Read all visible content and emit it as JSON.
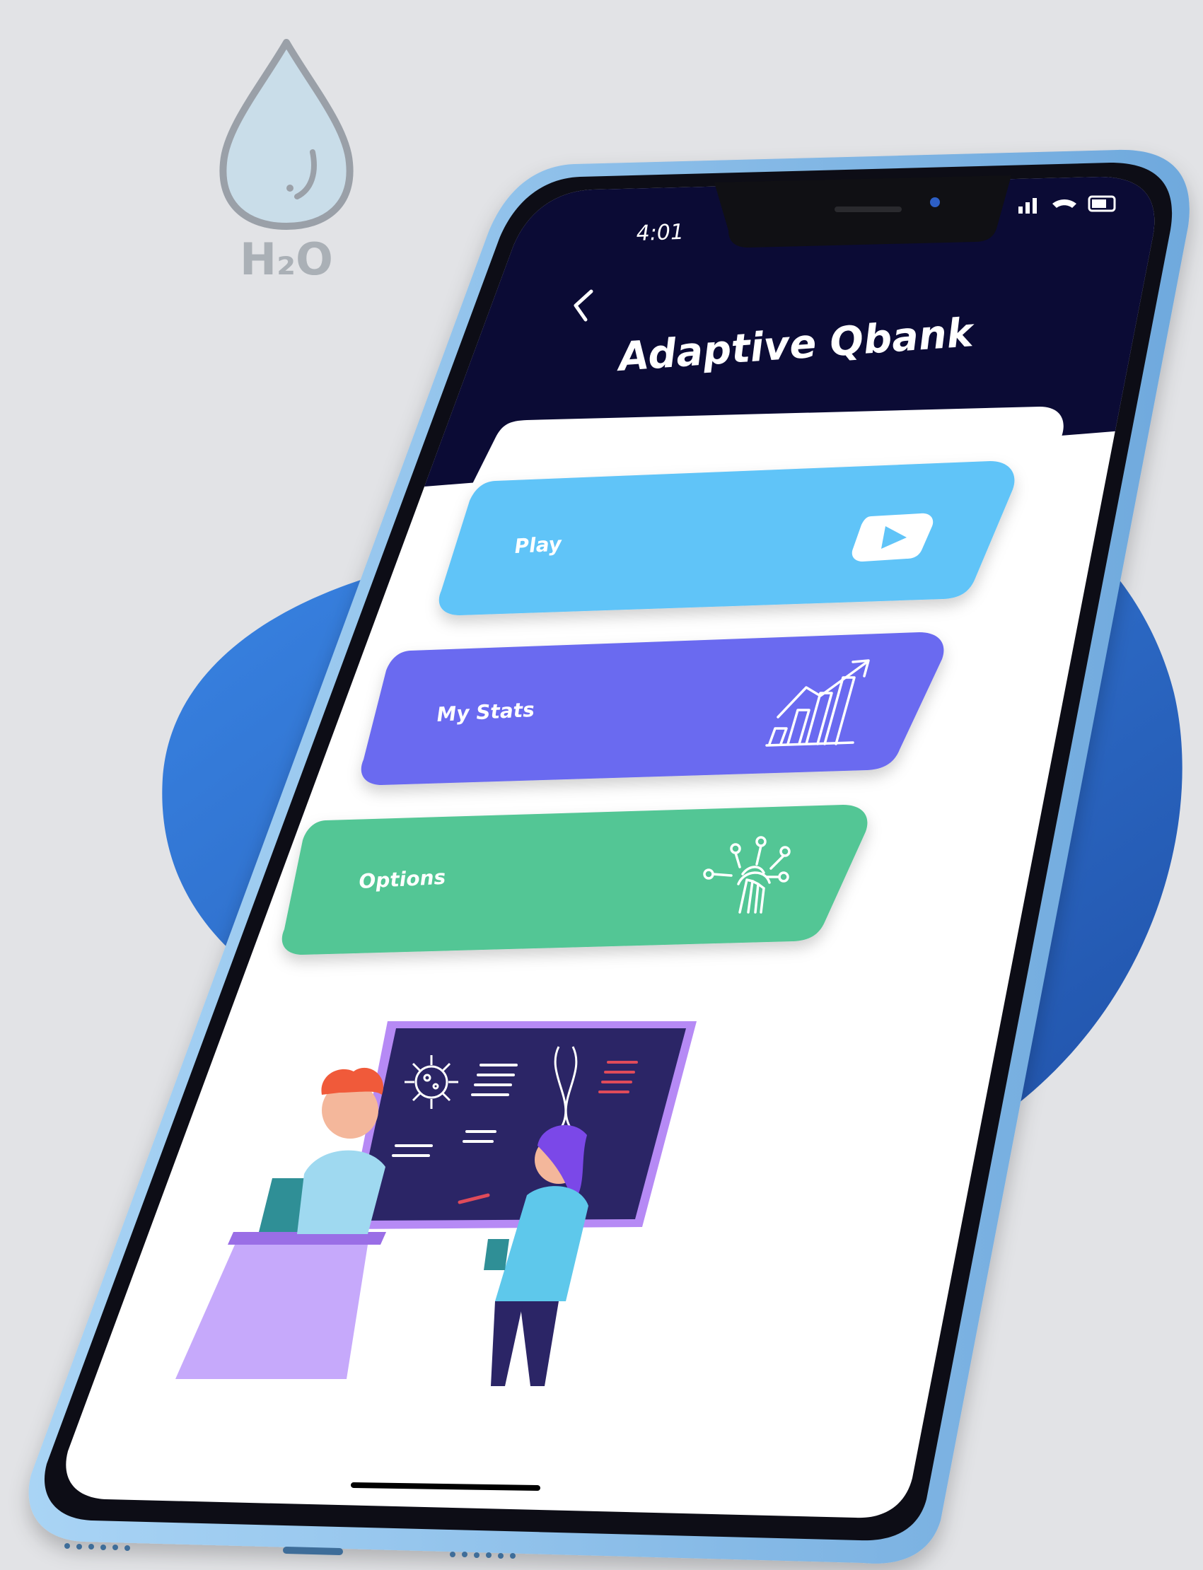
{
  "logo": {
    "text": "H₂O"
  },
  "status_bar": {
    "time": "4:01"
  },
  "header": {
    "back_icon": "chevron-left-icon",
    "title": "Adaptive Qbank"
  },
  "menu": [
    {
      "label": "Play",
      "icon": "play-icon",
      "color": "#61c4f8"
    },
    {
      "label": "My Stats",
      "icon": "chart-up-icon",
      "color": "#6b6bf0"
    },
    {
      "label": "Options",
      "icon": "touch-network-icon",
      "color": "#52c695"
    }
  ],
  "colors": {
    "background": "#e2e3e6",
    "blob": "#2f6ec9",
    "screen_header": "#0b0b35",
    "phone_frame": "#8fc3ec"
  }
}
